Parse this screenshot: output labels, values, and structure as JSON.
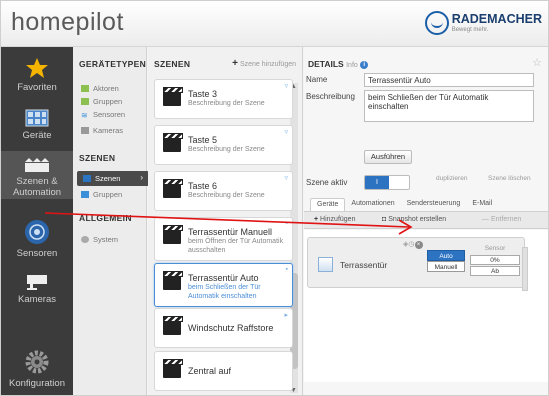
{
  "header": {
    "logo": "homepilot",
    "brand_name": "RADEMACHER",
    "brand_tagline": "Bewegt mehr."
  },
  "sidebar": {
    "items": [
      {
        "label": "Favoriten",
        "icon": "star-icon"
      },
      {
        "label": "Geräte",
        "icon": "devices-icon"
      },
      {
        "label": "Szenen & Automation",
        "icon": "scenes-icon"
      },
      {
        "label": "Sensoren",
        "icon": "sensor-icon"
      },
      {
        "label": "Kameras",
        "icon": "camera-icon"
      },
      {
        "label": "Konfiguration",
        "icon": "gear-icon"
      }
    ]
  },
  "categories": {
    "heading_types": "GERÄTETYPEN",
    "types": [
      {
        "label": "Aktoren",
        "color": "#8cc152"
      },
      {
        "label": "Gruppen",
        "color": "#8cc152"
      },
      {
        "label": "Sensoren",
        "color": "#3b8fd9"
      },
      {
        "label": "Kameras",
        "color": "#999999"
      }
    ],
    "heading_scenes": "SZENEN",
    "scenes": [
      {
        "label": "Szenen"
      },
      {
        "label": "Gruppen"
      }
    ],
    "heading_general": "ALLGEMEIN",
    "general": [
      {
        "label": "System"
      }
    ]
  },
  "scenes": {
    "heading": "SZENEN",
    "add_label": "Szene hinzufügen",
    "items": [
      {
        "title": "Taste 3",
        "desc": "Beschreibung der Szene"
      },
      {
        "title": "Taste 5",
        "desc": "Beschreibung der Szene"
      },
      {
        "title": "Taste 6",
        "desc": "Beschreibung der Szene"
      },
      {
        "title": "Terrassentür Manuell",
        "desc": "beim Öffnen der Tür Automatik ausschalten"
      },
      {
        "title": "Terrassentür Auto",
        "desc": "beim Schließen der Tür Automatik einschalten"
      },
      {
        "title": "Windschutz Raffstore",
        "desc": ""
      },
      {
        "title": "Zentral auf",
        "desc": ""
      }
    ]
  },
  "details": {
    "heading": "DETAILS",
    "sub": "Info",
    "name_label": "Name",
    "name_value": "Terrassentür Auto",
    "desc_label": "Beschreibung",
    "desc_value": "beim Schließen der Tür Automatik einschalten",
    "run_label": "Ausführen",
    "active_label": "Szene aktiv",
    "toggle_on": "I",
    "duplicate_label": "duplizieren",
    "delete_label": "Szene löschen",
    "tabs": [
      "Geräte",
      "Automationen",
      "Sendersteuerung",
      "E-Mail"
    ],
    "toolbar": {
      "add": "Hinzufügen",
      "snapshot": "Snapshot erstellen",
      "remove": "Entfernen"
    },
    "device": {
      "name": "Terrassentür",
      "btn_auto": "Auto",
      "btn_manual": "Manuell",
      "sensor_label": "Sensor",
      "sensor_on": "0%",
      "sensor_off": "Ab"
    }
  },
  "colors": {
    "accent": "#2c73c2",
    "star": "#f5b400",
    "arrow": "#e01414"
  }
}
